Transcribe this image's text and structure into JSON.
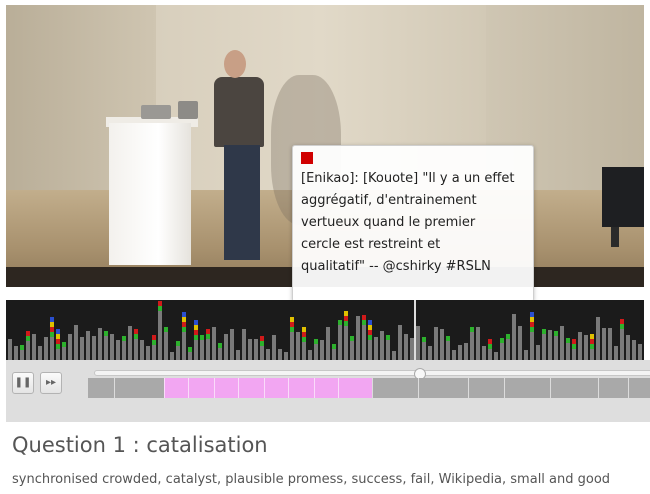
{
  "tooltip": {
    "marker_color": "#d00000",
    "lines": [
      "[Enikao]: [Kouote] \"Il y a un effet",
      "aggrégatif, d'entrainement",
      "vertueux quand le premier",
      "cercle est restreint et",
      "qualitatif\" -- @cshirky #RSLN"
    ]
  },
  "player": {
    "pause_icon": "pause-icon",
    "pause_symbol": "❚❚",
    "forward_icon": "forward-icon",
    "forward_symbol": "▸▸",
    "progress": 0.58,
    "highlight_color": "#f2a6f2",
    "segment_color": "#a9a9a9"
  },
  "question": {
    "title": "Question 1 : catalisation",
    "tags": "synchronised crowded, catalyst, plausible promess, success, fail, Wikipedia, small and good"
  },
  "colors": {
    "bar_default": "#7a7a7a",
    "bar_red": "#d01a1a",
    "bar_green": "#2db12d",
    "bar_yellow": "#e0c000",
    "bar_blue": "#2a4fd0"
  }
}
